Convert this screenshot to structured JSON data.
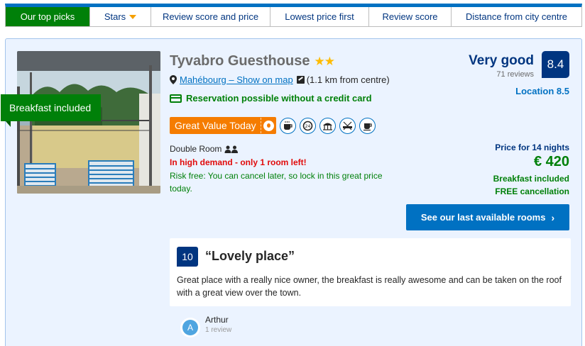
{
  "sort_bar": {
    "tabs": [
      {
        "label": "Our top picks",
        "active": true
      },
      {
        "label": "Stars",
        "has_dropdown": true
      },
      {
        "label": "Review score and price"
      },
      {
        "label": "Lowest price first"
      },
      {
        "label": "Review score"
      },
      {
        "label": "Distance from city centre"
      }
    ]
  },
  "property": {
    "ribbon": "Breakfast included",
    "name": "Tyvabro Guesthouse",
    "stars": "★★",
    "star_count": 2,
    "location_link": "Mahébourg – Show on map",
    "distance": "(1.1 km from centre)",
    "no_credit_card": "Reservation possible without a credit card",
    "badge": "Great Value Today",
    "amenity_icons": [
      "coffee-icon",
      "clock-icon",
      "beach-umbrella-icon",
      "no-smoking-icon",
      "coffee-cup-icon"
    ],
    "room_type": "Double Room",
    "demand": "In high demand - only 1 room left!",
    "risk_free": "Risk free: You can cancel later, so lock in this great price today.",
    "rating_word": "Very good",
    "reviews_count": "71 reviews",
    "score": "8.4",
    "location_score": "Location 8.5",
    "price_label": "Price for 14 nights",
    "price": "€ 420",
    "breakfast": "Breakfast included",
    "free_cancellation": "FREE cancellation",
    "cta_label": "See our last available rooms"
  },
  "review": {
    "score": "10",
    "title": "“Lovely place”",
    "text": "Great place with a really nice owner, the breakfast is really awesome and can be taken on the roof with a great view over the town.",
    "reviewer_initial": "A",
    "reviewer_name": "Arthur",
    "reviewer_count": "1 review"
  },
  "colors": {
    "brand_blue": "#003580",
    "link_blue": "#0071c2",
    "green": "#008009",
    "orange": "#f57c00",
    "urgent_red": "#e10b0b",
    "card_bg": "#ebf3ff"
  }
}
